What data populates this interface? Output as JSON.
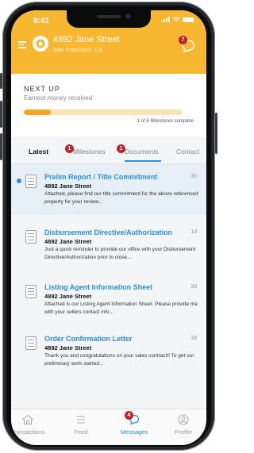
{
  "status_bar": {
    "time": "9:41"
  },
  "header": {
    "address": "4892 Jane Street",
    "city": "San Francisco, CA",
    "chat_badge": "7",
    "color": "#f7b731"
  },
  "next_up": {
    "title": "NEXT UP",
    "subtitle": "Earnest money received",
    "progress_fraction": 0.17,
    "milestones_text": "1 of 6 Milestones complete"
  },
  "tabs": [
    {
      "label": "Latest",
      "active": true,
      "badge": null
    },
    {
      "label": "Milestones",
      "active": false,
      "badge": "1"
    },
    {
      "label": "Documents",
      "active": false,
      "badge": "1"
    },
    {
      "label": "Contact",
      "active": false,
      "badge": null
    }
  ],
  "items": [
    {
      "title": "Prelim Report / Title Commitment",
      "time": "3h",
      "subtitle": "4892 Jane Street",
      "body": "Attached, please find our title commitment for the above referenced property for your review...",
      "unread": true
    },
    {
      "title": "Disbursement Directive/Authorization",
      "time": "1d",
      "subtitle": "4892 Jane Street",
      "body": "Just a quick reminder to provide our office with your Disbursement Directive/Authorization prior to close...",
      "unread": false
    },
    {
      "title": "Listing Agent Information Sheet",
      "time": "3d",
      "subtitle": "4892 Jane Street",
      "body": "Attached is our Listing Agent Information Sheet. Please provide me with your sellers contact info...",
      "unread": false
    },
    {
      "title": "Order Confirmation Letter",
      "time": "3d",
      "subtitle": "4892 Jane Street",
      "body": "Thank you and congratulations on your sales contract!! To get our preliminary work started...",
      "unread": false
    }
  ],
  "bottom_nav": [
    {
      "label": "Transactions",
      "icon": "house-icon",
      "active": false
    },
    {
      "label": "Feed",
      "icon": "list-icon",
      "active": false
    },
    {
      "label": "Messages",
      "icon": "chat-icon",
      "active": true,
      "badge": "4"
    },
    {
      "label": "Profile",
      "icon": "person-icon",
      "active": false
    }
  ],
  "colors": {
    "accent": "#2a8fd6",
    "badge": "#b7262c",
    "brand": "#f7b731"
  }
}
